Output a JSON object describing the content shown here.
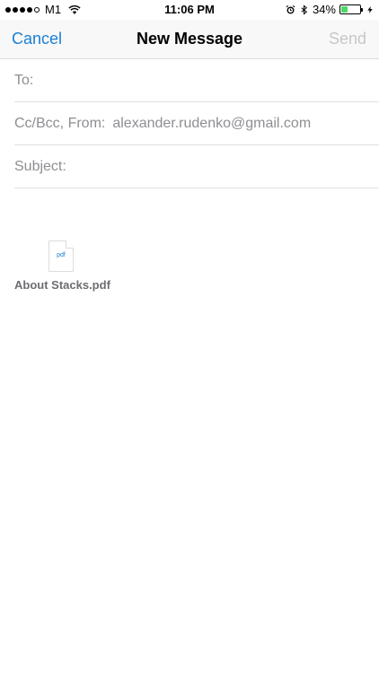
{
  "status_bar": {
    "carrier": "M1",
    "time": "11:06 PM",
    "battery_percent": "34%",
    "battery_level": 0.34,
    "signal_strength": 4,
    "signal_max": 5
  },
  "nav": {
    "cancel_label": "Cancel",
    "title": "New Message",
    "send_label": "Send"
  },
  "fields": {
    "to_label": "To:",
    "cc_label": "Cc/Bcc, From:",
    "from_address": "alexander.rudenko@gmail.com",
    "subject_label": "Subject:"
  },
  "attachment": {
    "type_label": "pdf",
    "filename": "About Stacks.pdf"
  },
  "colors": {
    "accent": "#1a7fd4",
    "disabled": "#c7c7cc",
    "battery": "#4cd964"
  }
}
